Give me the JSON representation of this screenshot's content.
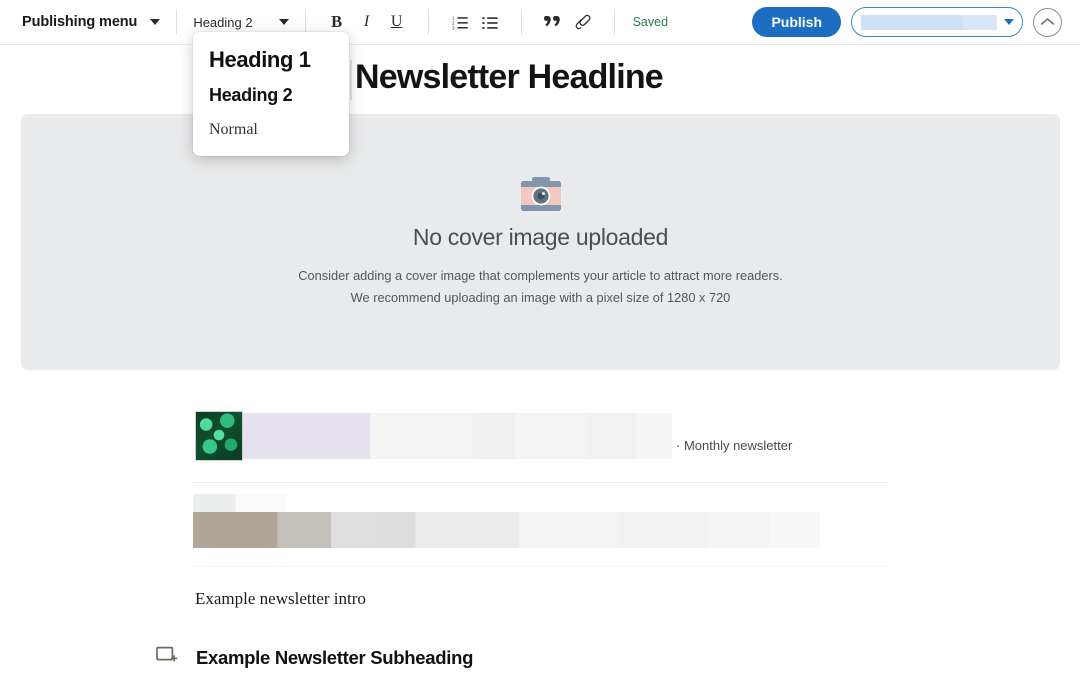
{
  "toolbar": {
    "publishing_menu_label": "Publishing menu",
    "publishing_menu_caret": "chevron-down-icon",
    "style_select_value": "Heading 2",
    "bold_label": "B",
    "italic_label": "I",
    "underline_label": "U",
    "ordered_list_icon": "ordered-list-icon",
    "bullet_list_icon": "bullet-list-icon",
    "quote_icon": "blockquote-icon",
    "link_icon": "link-icon",
    "save_status": "Saved",
    "publish_label": "Publish",
    "audience_select_value": "",
    "collapse_icon": "chevron-up-icon",
    "accent_color": "#1b6ec2",
    "saved_color": "#2e7d4f"
  },
  "style_dropdown": {
    "open": true,
    "options": [
      {
        "label": "Heading 1",
        "style": "h1"
      },
      {
        "label": "Heading 2",
        "style": "h2"
      },
      {
        "label": "Normal",
        "style": "normal"
      }
    ]
  },
  "editor": {
    "headline": "Newsletter Headline",
    "cover": {
      "icon": "camera-icon",
      "title": "No cover image uploaded",
      "subtitle_line1": "Consider adding a cover image that complements your article to attract more readers.",
      "subtitle_line2": "We recommend uploading an image with a pixel size of 1280 x 720",
      "background_color": "#e9eaeb"
    },
    "blocks": {
      "thumbnail_alt": "tropical-leaves-thumbnail",
      "row_label": "· Monthly newsletter",
      "intro_text": "Example newsletter intro",
      "add_block_icon": "add-image-block-icon",
      "subheading_text": "Example Newsletter Subheading"
    }
  }
}
